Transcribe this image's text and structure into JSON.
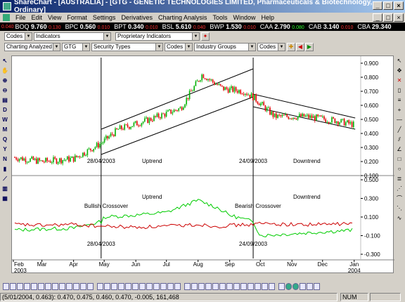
{
  "window": {
    "title": "ShareChart - [AUSTRALIA] - [GTG - GENETIC TECHNOLOGIES LIMITED, Pharmaceuticals & Biotechnology, Ordinary]",
    "buttons": [
      "_",
      "□",
      "×"
    ]
  },
  "menu": {
    "items": [
      "File",
      "Edit",
      "View",
      "Format",
      "Settings",
      "Derivatives",
      "Charting Analysis",
      "Tools",
      "Window",
      "Help"
    ],
    "mdi_buttons": [
      "_",
      "□",
      "×"
    ]
  },
  "ticker": {
    "lead": "0.040",
    "items": [
      {
        "code": "BOQ",
        "price": "9.760",
        "change": "0.130",
        "up": false
      },
      {
        "code": "BPC",
        "price": "0.560",
        "change": "0.010",
        "up": false
      },
      {
        "code": "BPT",
        "price": "0.340",
        "change": "0.010",
        "up": false
      },
      {
        "code": "BSL",
        "price": "5.610",
        "change": "0.040",
        "up": false
      },
      {
        "code": "BWP",
        "price": "1.530",
        "change": "0.010",
        "up": false
      },
      {
        "code": "CAA",
        "price": "2.790",
        "change": "0.080",
        "up": true
      },
      {
        "code": "CAB",
        "price": "3.140",
        "change": "0.010",
        "up": false
      },
      {
        "code": "CBA",
        "price": "29.340",
        "change": "",
        "up": false
      }
    ]
  },
  "toolbar1": {
    "codes": "Codes",
    "indicators": "Indicators",
    "proprietary": "Proprietary Indicators"
  },
  "toolbar2": {
    "charting": "Charting Analyzed Li",
    "security": "GTG",
    "types": "Security Types",
    "codes": "Codes",
    "groups": "Industry Groups",
    "codes2": "Codes"
  },
  "left_tools": [
    "D",
    "W",
    "M",
    "Q",
    "Y",
    "N"
  ],
  "chart_data": [
    {
      "type": "candlestick",
      "y_ticks": [
        "0.900",
        "0.800",
        "0.700",
        "0.600",
        "0.500",
        "0.400",
        "0.300",
        "0.200",
        "0.100"
      ],
      "ylim": [
        0.1,
        0.9
      ],
      "annotations": [
        {
          "text": "28/04/2003"
        },
        {
          "text": "Uptrend"
        },
        {
          "text": "24/09/2003"
        },
        {
          "text": "Downtrend"
        }
      ],
      "series": [
        {
          "x": [
            "2003-02-01",
            "2003-03-01",
            "2003-04-01",
            "2003-04-28",
            "2003-05-15",
            "2003-06-15",
            "2003-07-15",
            "2003-08-05",
            "2003-08-25",
            "2003-09-15",
            "2003-09-24",
            "2003-10-15",
            "2003-11-15",
            "2003-12-15",
            "2004-01-02"
          ],
          "values": [
            0.23,
            0.2,
            0.22,
            0.33,
            0.43,
            0.5,
            0.58,
            0.82,
            0.72,
            0.7,
            0.66,
            0.52,
            0.52,
            0.49,
            0.46
          ]
        }
      ],
      "channels": [
        {
          "name": "uptrend",
          "upper": [
            [
              "2003-04-28",
              0.43
            ],
            [
              "2003-09-24",
              0.86
            ]
          ],
          "lower": [
            [
              "2003-04-28",
              0.25
            ],
            [
              "2003-09-24",
              0.66
            ]
          ]
        },
        {
          "name": "downtrend",
          "upper": [
            [
              "2003-09-24",
              0.68
            ],
            [
              "2004-01-02",
              0.51
            ]
          ],
          "lower": [
            [
              "2003-09-24",
              0.59
            ],
            [
              "2004-01-02",
              0.43
            ]
          ]
        }
      ]
    },
    {
      "type": "line",
      "y_ticks": [
        "0.500",
        "0.400",
        "0.300",
        "0.200",
        "0.100",
        "0.000",
        "-0.100",
        "-0.200",
        "-0.300"
      ],
      "ylim": [
        -0.3,
        0.5
      ],
      "annotations": [
        {
          "text": "Bullish Crossover"
        },
        {
          "text": "Uptrend"
        },
        {
          "text": "Bearish Crossover"
        },
        {
          "text": "Downtrend"
        },
        {
          "text": "28/04/2003"
        },
        {
          "text": "24/09/2003"
        }
      ],
      "series": [
        {
          "color": "#00cc00",
          "x": [
            "2003-02",
            "2003-03",
            "2003-04",
            "2003-04-28",
            "2003-05",
            "2003-06",
            "2003-07",
            "2003-08",
            "2003-08-20",
            "2003-09",
            "2003-09-24",
            "2003-10",
            "2003-11",
            "2003-12",
            "2004-01"
          ],
          "values": [
            -0.04,
            -0.03,
            -0.02,
            0.05,
            0.1,
            0.12,
            0.15,
            0.28,
            0.2,
            0.12,
            0.05,
            -0.1,
            -0.08,
            -0.06,
            -0.04
          ]
        },
        {
          "color": "#cc0000",
          "x": [
            "2003-02",
            "2003-03",
            "2003-04",
            "2003-04-28",
            "2003-05",
            "2003-06",
            "2003-07",
            "2003-08",
            "2003-08-20",
            "2003-09",
            "2003-09-24",
            "2003-10",
            "2003-11",
            "2003-12",
            "2004-01"
          ],
          "values": [
            0.02,
            0.01,
            0.02,
            0.0,
            0.0,
            -0.01,
            0.0,
            0.02,
            0.0,
            0.01,
            0.02,
            0.03,
            0.02,
            0.02,
            0.03
          ]
        }
      ]
    }
  ],
  "x_axis": {
    "months": [
      "Feb",
      "Mar",
      "Apr",
      "May",
      "Jun",
      "Jul",
      "Aug",
      "Sep",
      "Oct",
      "Nov",
      "Dec",
      "Jan"
    ],
    "year_start": "2003",
    "year_end": "2004"
  },
  "status": {
    "info": "(5/01/2004, 0.463): 0.470, 0.475, 0.460, 0.470, -0.005, 161,468",
    "num": "NUM"
  }
}
